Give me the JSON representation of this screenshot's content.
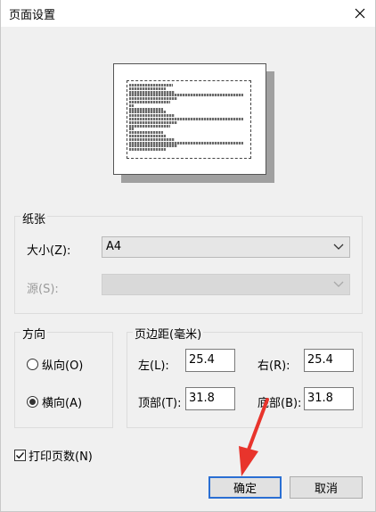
{
  "window": {
    "title": "页面设置",
    "close_icon": "close-icon"
  },
  "paper_group": {
    "label": "纸张",
    "size_label": "大小(Z):",
    "size_value": "A4",
    "source_label": "源(S):",
    "source_value": ""
  },
  "orientation_group": {
    "label": "方向",
    "portrait_label": "纵向(O)",
    "landscape_label": "横向(A)",
    "selected": "landscape"
  },
  "margins_group": {
    "label": "页边距(毫米)",
    "left_label": "左(L):",
    "left_value": "25.4",
    "right_label": "右(R):",
    "right_value": "25.4",
    "top_label": "顶部(T):",
    "top_value": "31.8",
    "bottom_label": "底部(B):",
    "bottom_value": "31.8"
  },
  "print_page_numbers": {
    "label": "打印页数(N)",
    "checked": true
  },
  "buttons": {
    "ok_label": "确定",
    "cancel_label": "取消"
  },
  "annotation": {
    "arrow_color": "#e8342c"
  },
  "colors": {
    "dialog_bg": "#f0f0f0",
    "default_button_border": "#2a6fd3"
  }
}
